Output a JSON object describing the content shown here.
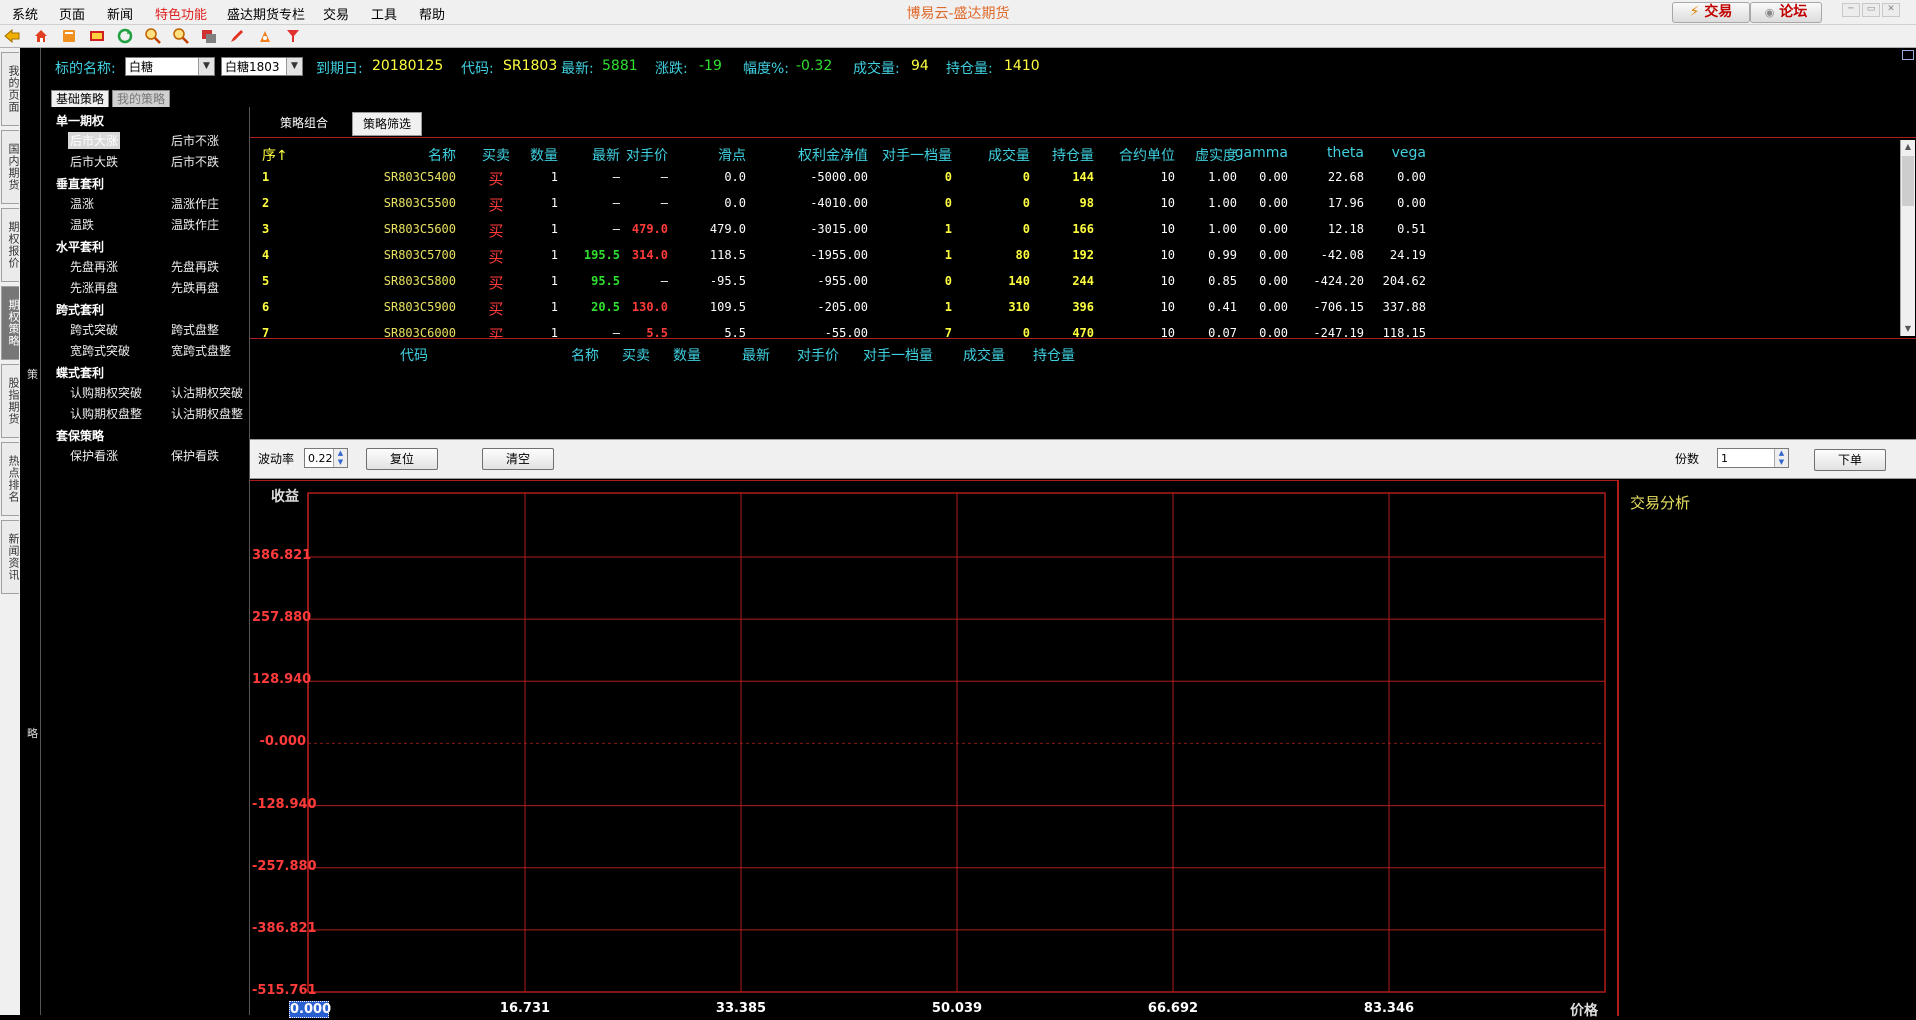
{
  "menubar": {
    "items": [
      "系统",
      "页面",
      "新闻",
      "特色功能",
      "盛达期货专栏",
      "交易",
      "工具",
      "帮助"
    ],
    "title": "博易云-盛达期货",
    "trade_button": "交易",
    "forum_button": "论坛"
  },
  "left_tabs": [
    "我的页面",
    "国内期货",
    "期权报价",
    "期权策略",
    "股指期货",
    "热点排名",
    "新闻资讯"
  ],
  "side_chars": {
    "top": "策",
    "bottom": "略"
  },
  "infobar": {
    "underlying_label": "标的名称:",
    "underlying_value": "白糖",
    "contract_value": "白糖1803",
    "expiry_label": "到期日:",
    "expiry_value": "20180125",
    "code_label": "代码:",
    "code_value": "SR1803",
    "last_label": "最新:",
    "last_value": "5881",
    "change_label": "涨跌:",
    "change_value": "-19",
    "pct_label": "幅度%:",
    "pct_value": "-0.32",
    "volume_label": "成交量:",
    "volume_value": "94",
    "oi_label": "持仓量:",
    "oi_value": "1410"
  },
  "strategy_tabs": [
    "基础策略",
    "我的策略"
  ],
  "strategy_groups": [
    {
      "name": "单一期权",
      "items": [
        "后市大涨",
        "后市不涨",
        "后市大跌",
        "后市不跌"
      ]
    },
    {
      "name": "垂直套利",
      "items": [
        "温涨",
        "温涨作庄",
        "温跌",
        "温跌作庄"
      ]
    },
    {
      "name": "水平套利",
      "items": [
        "先盘再涨",
        "先盘再跌",
        "先涨再盘",
        "先跌再盘"
      ]
    },
    {
      "name": "跨式套利",
      "items": [
        "跨式突破",
        "跨式盘整",
        "宽跨式突破",
        "宽跨式盘整"
      ]
    },
    {
      "name": "蝶式套利",
      "items": [
        "认购期权突破",
        "认沽期权突破",
        "认购期权盘整",
        "认沽期权盘整"
      ]
    },
    {
      "name": "套保策略",
      "items": [
        "保护看涨",
        "保护看跌"
      ]
    }
  ],
  "filter_tabs": [
    "策略组合",
    "策略筛选"
  ],
  "table": {
    "headers": [
      "序↑",
      "名称",
      "买卖",
      "数量",
      "最新",
      "对手价",
      "滑点",
      "权利金净值",
      "对手一档量",
      "成交量",
      "持仓量",
      "合约单位",
      "虚实度",
      "gamma",
      "theta",
      "vega"
    ],
    "rows": [
      [
        "1",
        "SR803C5400",
        "买",
        "1",
        "—",
        "—",
        "0.0",
        "-5000.00",
        "0",
        "0",
        "144",
        "10",
        "1.00",
        "0.00",
        "22.68",
        "0.00"
      ],
      [
        "2",
        "SR803C5500",
        "买",
        "1",
        "—",
        "—",
        "0.0",
        "-4010.00",
        "0",
        "0",
        "98",
        "10",
        "1.00",
        "0.00",
        "17.96",
        "0.00"
      ],
      [
        "3",
        "SR803C5600",
        "买",
        "1",
        "—",
        "479.0",
        "479.0",
        "-3015.00",
        "1",
        "0",
        "166",
        "10",
        "1.00",
        "0.00",
        "12.18",
        "0.51"
      ],
      [
        "4",
        "SR803C5700",
        "买",
        "1",
        "195.5",
        "314.0",
        "118.5",
        "-1955.00",
        "1",
        "80",
        "192",
        "10",
        "0.99",
        "0.00",
        "-42.08",
        "24.19"
      ],
      [
        "5",
        "SR803C5800",
        "买",
        "1",
        "95.5",
        "—",
        "-95.5",
        "-955.00",
        "0",
        "140",
        "244",
        "10",
        "0.85",
        "0.00",
        "-424.20",
        "204.62"
      ],
      [
        "6",
        "SR803C5900",
        "买",
        "1",
        "20.5",
        "130.0",
        "109.5",
        "-205.00",
        "1",
        "310",
        "396",
        "10",
        "0.41",
        "0.00",
        "-706.15",
        "337.88"
      ],
      [
        "7",
        "SR803C6000",
        "买",
        "1",
        "—",
        "5.5",
        "5.5",
        "-55.00",
        "7",
        "0",
        "470",
        "10",
        "0.07",
        "0.00",
        "-247.19",
        "118.15"
      ]
    ]
  },
  "lower_table": {
    "headers": [
      "代码",
      "名称",
      "买卖",
      "数量",
      "最新",
      "对手价",
      "对手一档量",
      "成交量",
      "持仓量"
    ]
  },
  "controls": {
    "vol_label": "波动率",
    "vol_value": "0.22",
    "reset_button": "复位",
    "clear_button": "清空",
    "qty_label": "份数",
    "qty_value": "1",
    "order_button": "下单"
  },
  "chart_data": {
    "type": "line",
    "ylabel": "收益",
    "xlabel": "价格",
    "y_ticks": [
      "386.821",
      "257.880",
      "128.940",
      "-0.000",
      "-128.940",
      "-257.880",
      "-386.821",
      "-515.761"
    ],
    "x_ticks": [
      "0.000",
      "16.731",
      "33.385",
      "50.039",
      "66.692",
      "83.346"
    ],
    "ylim": [
      -515.761,
      515.761
    ],
    "xlim": [
      0,
      100
    ],
    "grid": true,
    "series": []
  },
  "analysis": {
    "title": "交易分析"
  },
  "colors": {
    "cyan": "#40d0e0",
    "yellow": "#ffff40",
    "green": "#30e030",
    "red": "#ff3b3b",
    "grid": "#b01c1c"
  }
}
